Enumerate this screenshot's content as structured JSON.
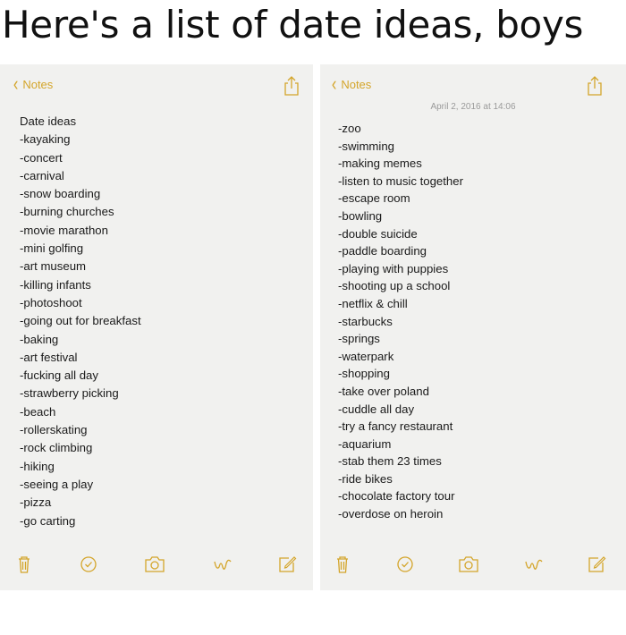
{
  "caption": "Here's a list of date ideas, boys",
  "accent_color": "#d4a52a",
  "left_note": {
    "back_label": "Notes",
    "lines": [
      "Date ideas",
      "-kayaking",
      "-concert",
      "-carnival",
      "-snow boarding",
      "-burning churches",
      "-movie marathon",
      "-mini golfing",
      "-art museum",
      "-killing infants",
      "-photoshoot",
      "-going out for breakfast",
      "-baking",
      "-art festival",
      "-fucking all day",
      "-strawberry picking",
      "-beach",
      "-rollerskating",
      "-rock climbing",
      "-hiking",
      "-seeing a play",
      "-pizza",
      "-go carting"
    ],
    "toolbar": [
      "trash-icon",
      "checklist-icon",
      "camera-icon",
      "sketch-icon",
      "compose-icon"
    ]
  },
  "right_note": {
    "back_label": "Notes",
    "timestamp": "April 2, 2016 at 14:06",
    "lines": [
      "-zoo",
      "-swimming",
      "-making memes",
      "-listen to music together",
      "-escape room",
      "-bowling",
      "-double suicide",
      "-paddle boarding",
      "-playing with puppies",
      "-shooting up a school",
      "-netflix & chill",
      "-starbucks",
      "-springs",
      "-waterpark",
      "-shopping",
      "-take over poland",
      "-cuddle all day",
      "-try a fancy restaurant",
      "-aquarium",
      "-stab them 23 times",
      "-ride bikes",
      "-chocolate factory tour",
      "-overdose on heroin"
    ],
    "toolbar": [
      "trash-icon",
      "checklist-icon",
      "camera-icon",
      "sketch-icon",
      "compose-icon"
    ]
  }
}
